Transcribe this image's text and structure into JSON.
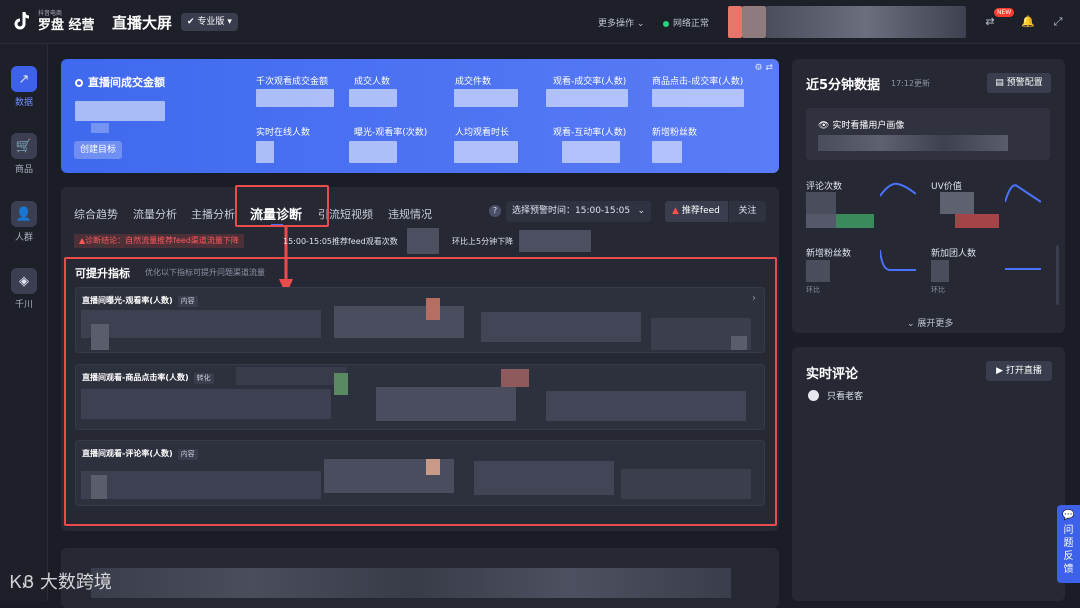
{
  "brand": {
    "sub": "抖音电商",
    "main": "罗盘 经营"
  },
  "header": {
    "title": "直播大屏",
    "edition": "专业版",
    "more_ops": "更多操作",
    "network": "网络正常",
    "new_badge": "NEW"
  },
  "sidebar": {
    "items": [
      {
        "label": "数据",
        "icon": "chart-icon",
        "active": true
      },
      {
        "label": "商品",
        "icon": "cart-icon",
        "active": false
      },
      {
        "label": "人群",
        "icon": "people-icon",
        "active": false
      },
      {
        "label": "千川",
        "icon": "qianchuan-icon",
        "active": false
      }
    ]
  },
  "banner": {
    "title": "直播间成交金额",
    "create_target": "创建目标",
    "metrics": [
      "千次观看成交金额",
      "成交人数",
      "成交件数",
      "观看-成交率(人数)",
      "商品点击-成交率(人数)",
      "实时在线人数",
      "曝光-观看率(次数)",
      "人均观看时长",
      "观看-互动率(人数)",
      "新增粉丝数"
    ]
  },
  "tabs": {
    "items": [
      "综合趋势",
      "流量分析",
      "主播分析",
      "流量诊断",
      "引流短视频",
      "违规情况"
    ],
    "active_index": 3
  },
  "controls": {
    "time_label": "选择预警时间：15:00-15:05",
    "feed_label": "推荐feed",
    "follow_label": "关注"
  },
  "diagnosis": {
    "conclusion": "诊断结论：自然流量推荐feed渠道流量下降",
    "window": "15:00-15:05推荐feed观看次数",
    "compare": "环比上5分钟下降"
  },
  "improve": {
    "title": "可提升指标",
    "hint": "优化以下指标可提升问题渠道流量",
    "cards": [
      {
        "title": "直播间曝光-观看率(人数)",
        "tag": "内容"
      },
      {
        "title": "直播间观看-商品点击率(人数)",
        "tag": "转化"
      },
      {
        "title": "直播间观看-评论率(人数)",
        "tag": "内容"
      }
    ]
  },
  "right": {
    "recent_title": "近5分钟数据",
    "recent_time": "17:12更新",
    "warn_config": "预警配置",
    "portrait": "实时看播用户画像",
    "mini": [
      "评论次数",
      "UV价值",
      "新增粉丝数",
      "新加团人数"
    ],
    "mini_sub": "环比",
    "expand": "展开更多",
    "comments_title": "实时评论",
    "open_live": "打开直播",
    "old_only": "只看老客"
  },
  "feedback": {
    "label": "问题反馈"
  },
  "watermark": {
    "text": "大数跨境"
  },
  "colors": {
    "accent": "#3d61e8",
    "alert": "#ea4b4b",
    "bg": "#1b1d26",
    "panel": "#262834"
  }
}
